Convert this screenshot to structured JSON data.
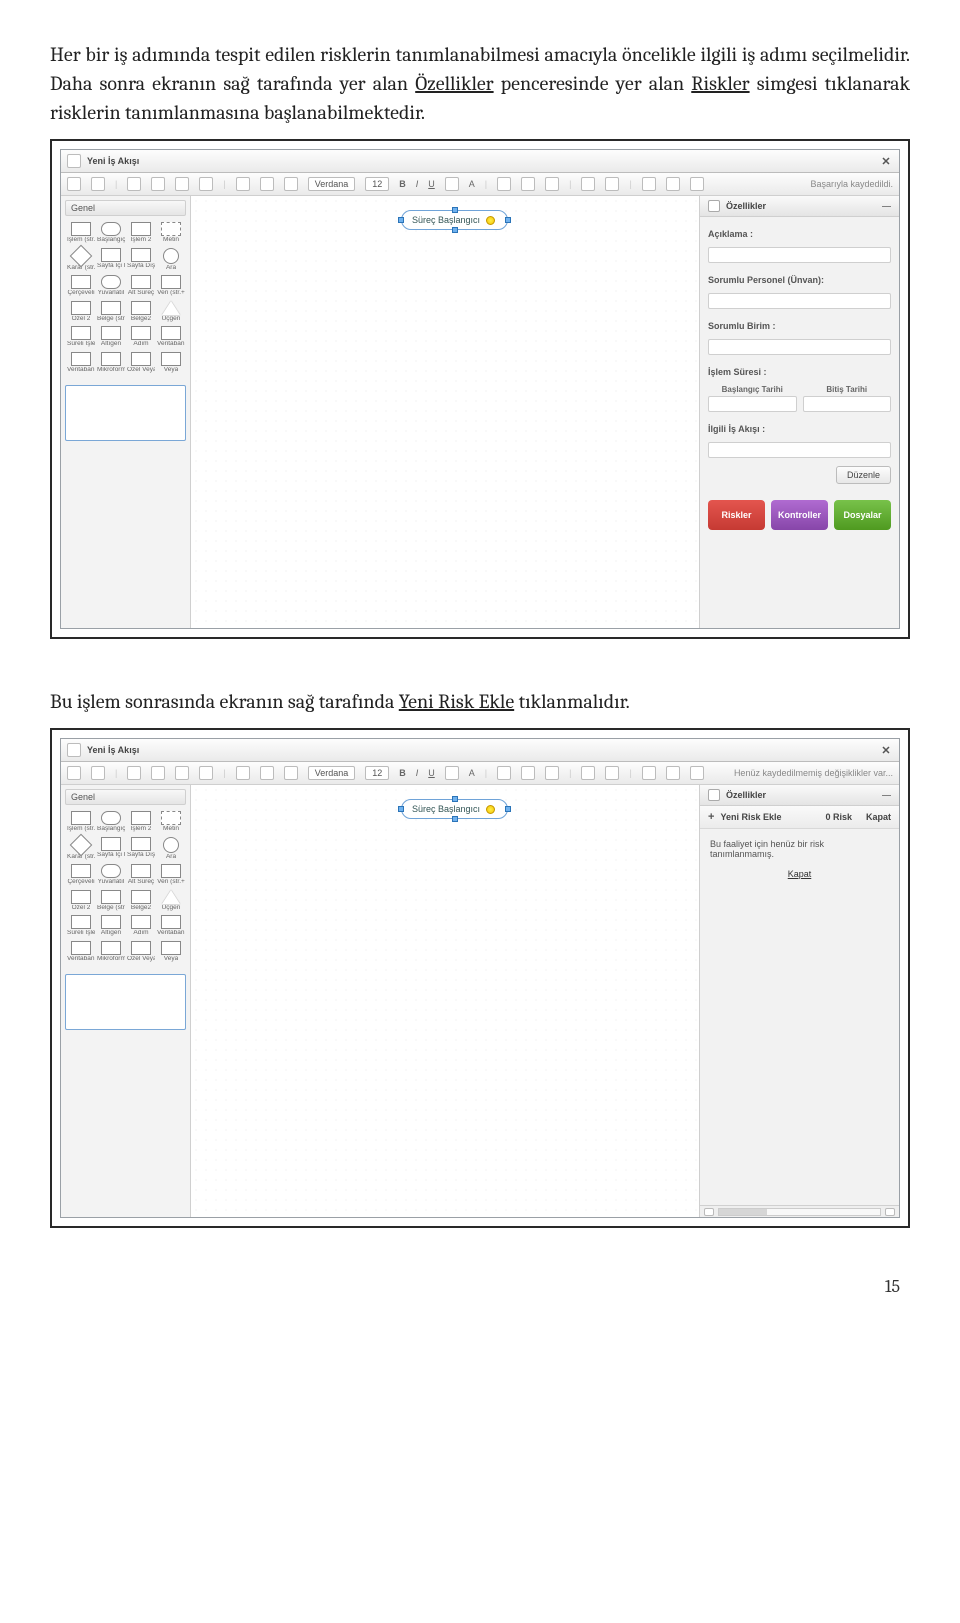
{
  "para1": {
    "s1": "Her bir iş adımında tespit edilen risklerin tanımlanabilmesi amacıyla öncelikle ilgili iş adımı seçilmelidir. Daha sonra ekranın sağ tarafında yer alan ",
    "u1": "Özellikler",
    "s2": " penceresinde yer alan ",
    "u2": "Riskler",
    "s3": " simgesi tıklanarak risklerin tanımlanmasına başlanabilmektedir."
  },
  "para2": {
    "s1": "Bu işlem sonrasında ekranın sağ tarafında ",
    "u1": "Yeni Risk Ekle",
    "s2": " tıklanmalıdır."
  },
  "app": {
    "title": "Yeni İş Akışı",
    "toolbar": {
      "font": "Verdana",
      "size": "12",
      "status_saved": "Başarıyla kaydedildi.",
      "status_unsaved": "Henüz kaydedilmemiş değişiklikler var..."
    },
    "palette": {
      "header": "Genel",
      "items": [
        "İşlem (str.",
        "Başlangıç",
        "İşlem 2",
        "Metin",
        "Karar (str.",
        "Sayfa İçi I",
        "Sayfa Dış",
        "Ara",
        "Çerçeveli",
        "Yuvarlatıl",
        "Alt Süreç",
        "Veri (str.+",
        "Özel 2",
        "Belge (str.",
        "Belge2",
        "Üçgen",
        "Süreli İşle",
        "Altıgen",
        "Adım",
        "Veritabanı",
        "Veritabanı",
        "Mikroform",
        "Özel Veya",
        "Veya"
      ]
    },
    "node_label": "Süreç Başlangıcı",
    "props": {
      "panel_title": "Özellikler",
      "aciklama": "Açıklama :",
      "personel": "Sorumlu Personel (Ünvan):",
      "birim": "Sorumlu Birim :",
      "sure": "İşlem Süresi :",
      "baslangic": "Başlangıç Tarihi",
      "bitis": "Bitiş Tarihi",
      "ilgili": "İlgili İş Akışı :",
      "duzenle": "Düzenle",
      "riskler": "Riskler",
      "kontroller": "Kontroller",
      "dosyalar": "Dosyalar"
    },
    "risks": {
      "add": "Yeni Risk Ekle",
      "count_lbl": "0  Risk",
      "kapat": "Kapat",
      "msg": "Bu faaliyet için henüz bir risk tanımlanmamış.",
      "kapat2": "Kapat"
    }
  },
  "page_num": "15"
}
